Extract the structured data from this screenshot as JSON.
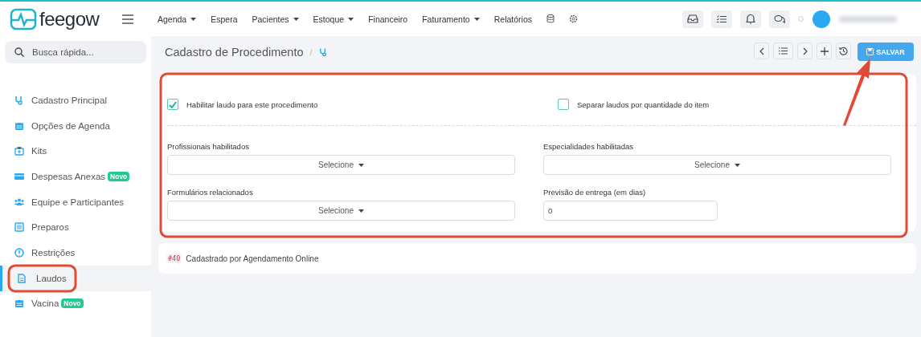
{
  "brand": {
    "name": "feegow"
  },
  "nav": [
    {
      "label": "Agenda",
      "dropdown": true
    },
    {
      "label": "Espera",
      "dropdown": false
    },
    {
      "label": "Pacientes",
      "dropdown": true
    },
    {
      "label": "Estoque",
      "dropdown": true
    },
    {
      "label": "Financeiro",
      "dropdown": false
    },
    {
      "label": "Faturamento",
      "dropdown": true
    },
    {
      "label": "Relatórios",
      "dropdown": false
    }
  ],
  "search": {
    "placeholder": "Busca rápida..."
  },
  "sidebar": {
    "items": [
      {
        "label": "Cadastro Principal",
        "selected": false
      },
      {
        "label": "Opções de Agenda",
        "selected": false
      },
      {
        "label": "Kits",
        "selected": false
      },
      {
        "label": "Despesas Anexas",
        "selected": false,
        "badge": "Novo"
      },
      {
        "label": "Equipe e Participantes",
        "selected": false
      },
      {
        "label": "Preparos",
        "selected": false
      },
      {
        "label": "Restrições",
        "selected": false
      },
      {
        "label": "Laudos",
        "selected": true
      },
      {
        "label": "Vacina",
        "selected": false,
        "badge": "Novo"
      }
    ]
  },
  "page": {
    "title": "Cadastro de Procedimento",
    "separator": "/",
    "save_button": "SALVAR"
  },
  "form": {
    "checkboxes": [
      {
        "label": "Habilitar laudo para este procedimento",
        "checked": true
      },
      {
        "label": "Separar laudos por quantidade do item",
        "checked": false
      }
    ],
    "fields": [
      {
        "kind": "select",
        "label": "Profissionais habilitados",
        "value": "Selecione"
      },
      {
        "kind": "select",
        "label": "Especialidades habilitadas",
        "value": "Selecione"
      },
      {
        "kind": "select",
        "label": "Formulários relacionados",
        "value": "Selecione"
      },
      {
        "kind": "input",
        "label": "Previsão de entrega (em dias)",
        "value": "0"
      }
    ]
  },
  "note": {
    "tag": "#40",
    "text": "Cadastrado por Agendamento Online"
  }
}
